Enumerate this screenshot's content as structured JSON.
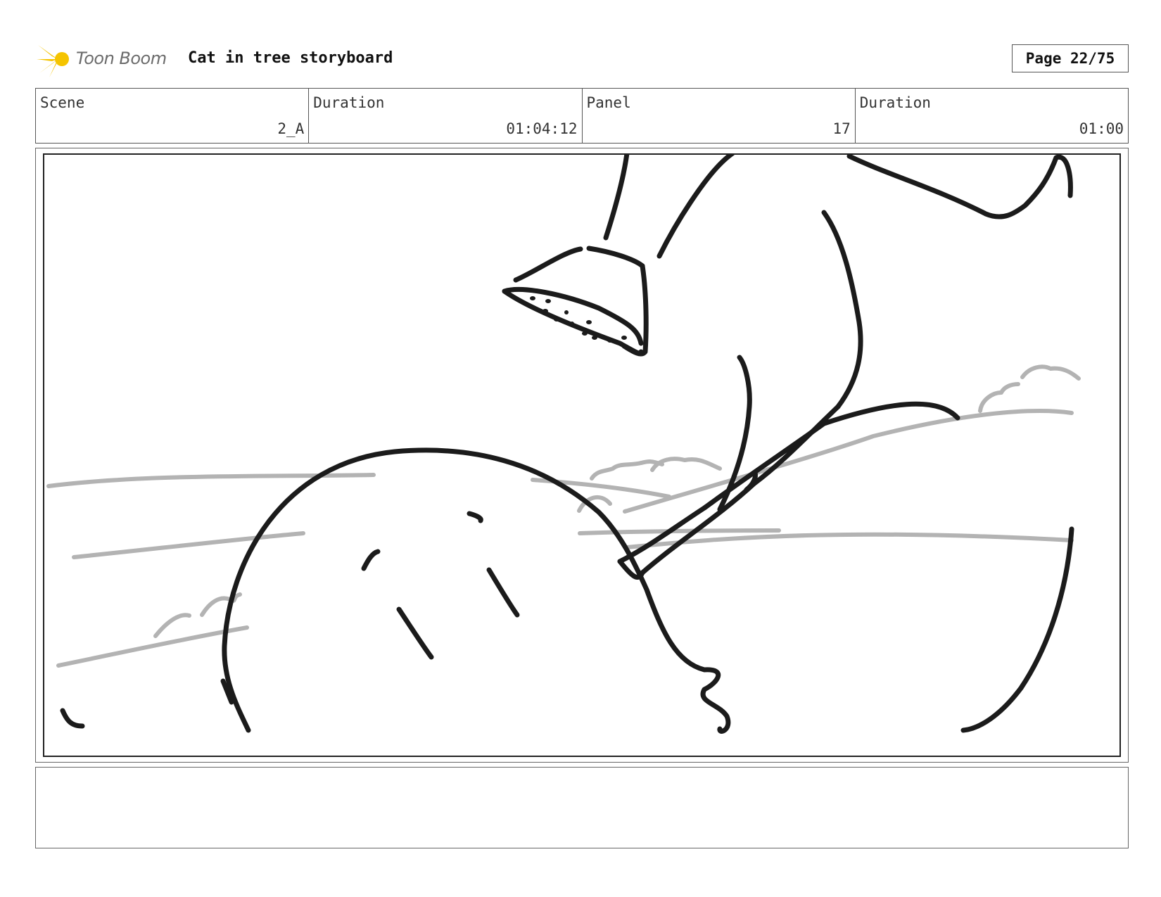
{
  "header": {
    "logo_text": "Toon Boom",
    "title": "Cat in tree storyboard",
    "page": "Page 22/75"
  },
  "info": {
    "scene_label": "Scene",
    "scene_value": "2_A",
    "scene_duration_label": "Duration",
    "scene_duration_value": "01:04:12",
    "panel_label": "Panel",
    "panel_value": "17",
    "panel_duration_label": "Duration",
    "panel_duration_value": "01:00"
  },
  "colors": {
    "logo_star": "#f5c400",
    "sketch_ink": "#1b1b1b",
    "sketch_background": "#b3b3b3"
  },
  "panel": {
    "drawing": "storyboard sketch"
  },
  "notes": {
    "text": ""
  }
}
